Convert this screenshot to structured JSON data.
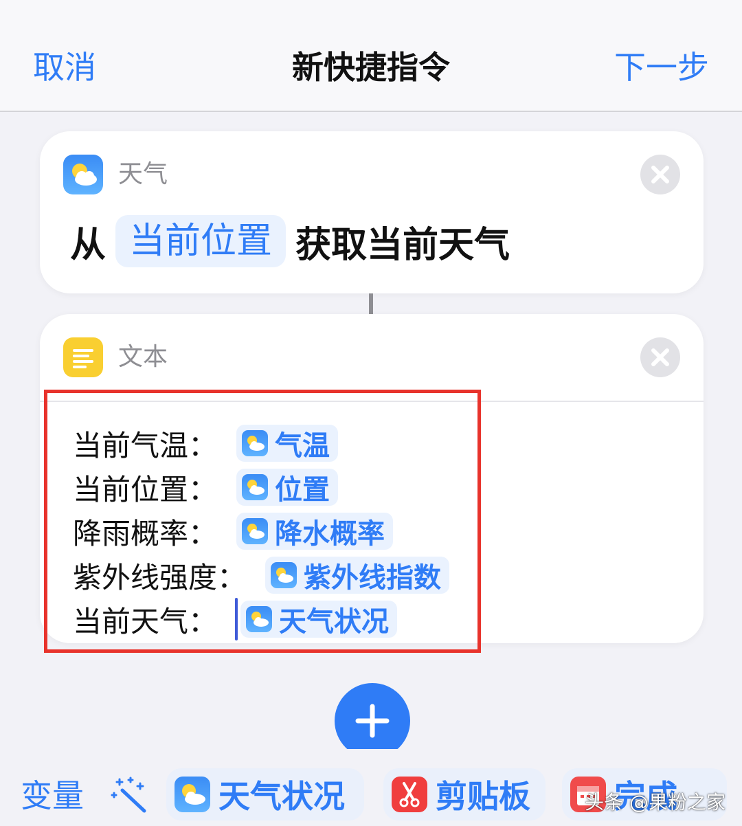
{
  "nav": {
    "cancel": "取消",
    "title": "新快捷指令",
    "next": "下一步"
  },
  "weather_card": {
    "app_label": "天气",
    "prefix": "从",
    "location_token": "当前位置",
    "suffix": "获取当前天气",
    "icon": "weather-app-icon"
  },
  "text_card": {
    "app_label": "文本",
    "icon": "text-app-icon",
    "lines": [
      {
        "label": "当前气温：",
        "token": "气温"
      },
      {
        "label": "当前位置：",
        "token": "位置"
      },
      {
        "label": "降雨概率：",
        "token": "降水概率"
      },
      {
        "label": "紫外线强度：",
        "token": "紫外线指数"
      },
      {
        "label": "当前天气：",
        "token": "天气状况"
      }
    ]
  },
  "toolbar": {
    "variables": "变量",
    "chips": [
      {
        "label": "天气状况",
        "icon": "weather-icon"
      },
      {
        "label": "剪贴板",
        "icon": "scissors-icon"
      },
      {
        "label": "完成",
        "icon": "calendar-icon"
      }
    ]
  },
  "watermark": "头条 @果粉之家",
  "colors": {
    "accent": "#2f7cf6",
    "highlight_border": "#e8332c",
    "background": "#f2f2f7"
  }
}
